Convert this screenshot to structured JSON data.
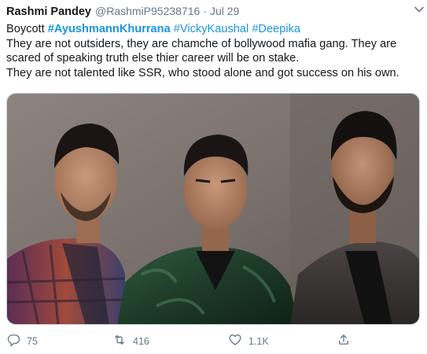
{
  "tweet": {
    "author_name": "Rashmi Pandey",
    "handle": "@RashmiP95238716",
    "separator": "·",
    "date": "Jul 29",
    "lines": [
      {
        "segments": [
          {
            "text": "Boycott ",
            "kind": "plain"
          },
          {
            "text": "#AyushmannKhurrana",
            "kind": "hashtag-bold"
          },
          {
            "text": " ",
            "kind": "plain"
          },
          {
            "text": "#VickyKaushal",
            "kind": "hashtag"
          },
          {
            "text": " ",
            "kind": "plain"
          },
          {
            "text": "#Deepika",
            "kind": "hashtag"
          }
        ]
      },
      {
        "segments": [
          {
            "text": "They are not outsiders, they are chamche of bollywood mafia gang. They are",
            "kind": "plain"
          }
        ]
      },
      {
        "segments": [
          {
            "text": "scared of speaking truth else thier career will be on stake.",
            "kind": "plain"
          }
        ]
      },
      {
        "segments": [
          {
            "text": "They are not talented like SSR, who stood alone and got success on his own.",
            "kind": "plain"
          }
        ]
      }
    ]
  },
  "actions": {
    "reply_count": "75",
    "retweet_count": "416",
    "like_count": "1.1K"
  },
  "icons": {
    "caret": "chevron-down-icon",
    "reply": "reply-icon",
    "retweet": "retweet-icon",
    "like": "heart-icon",
    "share": "share-icon"
  },
  "colors": {
    "link": "#1b95e0",
    "muted": "#657786",
    "text": "#14171a"
  }
}
